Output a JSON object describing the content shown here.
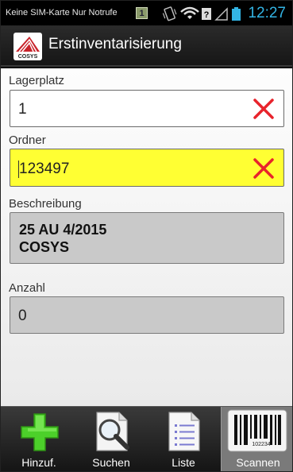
{
  "status_bar": {
    "carrier_text": "Keine SIM-Karte Nur Notrufe",
    "sim_badge": "1",
    "time": "12:27"
  },
  "title_bar": {
    "title": "Erstinventarisierung",
    "logo_text": "COSYS"
  },
  "form": {
    "lagerplatz": {
      "label": "Lagerplatz",
      "value": "1"
    },
    "ordner": {
      "label": "Ordner",
      "value": "123497"
    },
    "beschreibung": {
      "label": "Beschreibung",
      "line1": "25 AU 4/2015",
      "line2": "COSYS"
    },
    "anzahl": {
      "label": "Anzahl",
      "value": "0"
    }
  },
  "bottom_bar": {
    "items": [
      {
        "label": "Hinzuf.",
        "icon": "plus-icon"
      },
      {
        "label": "Suchen",
        "icon": "search-document-icon"
      },
      {
        "label": "Liste",
        "icon": "list-document-icon"
      },
      {
        "label": "Scannen",
        "icon": "barcode-icon"
      }
    ],
    "barcode_number": "102234"
  },
  "colors": {
    "clock": "#33b5e5",
    "active_field": "#ffff33",
    "readonly_field": "#c9c9c9",
    "clear_x": "#e8232b",
    "plus_green": "#4cd02a"
  }
}
